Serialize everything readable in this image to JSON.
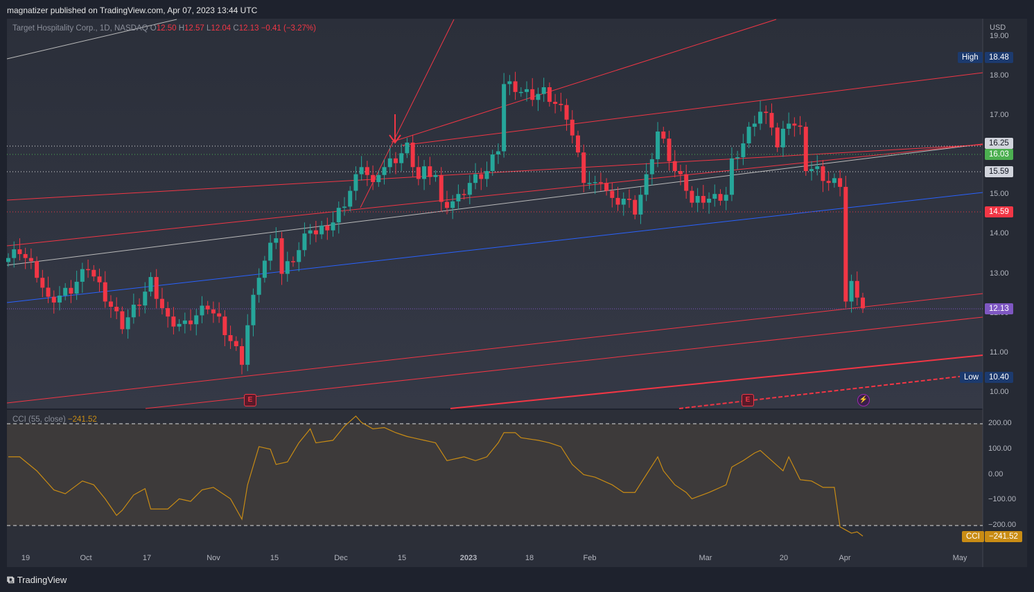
{
  "header": {
    "published": "magnatizer published on TradingView.com, Apr 07, 2023 13:44 UTC"
  },
  "legend": {
    "symbol": "Target Hospitality Corp., 1D, NASDAQ",
    "o_label": "O",
    "open": "12.50",
    "h_label": "H",
    "high": "12.57",
    "l_label": "L",
    "low": "12.04",
    "c_label": "C",
    "close": "12.13",
    "change": "−0.41 (−3.27%)"
  },
  "price_axis": {
    "currency": "USD",
    "ticks": [
      "19.00",
      "18.00",
      "17.00",
      "16.00",
      "15.00",
      "14.00",
      "13.00",
      "12.00",
      "11.00",
      "10.00"
    ]
  },
  "tags": {
    "high_label": "High",
    "high": "18.48",
    "low_label": "Low",
    "low": "10.40",
    "t1": "16.25",
    "t2": "16.03",
    "t3": "15.59",
    "t4": "14.59",
    "last": "12.13",
    "cci_label": "CCI",
    "cci": "−241.52"
  },
  "cci": {
    "title": "CCI (55, close)",
    "value": "−241.52",
    "ticks": [
      "200.00",
      "100.00",
      "0.00",
      "−100.00",
      "−200.00"
    ]
  },
  "time_axis": [
    "19",
    "Oct",
    "17",
    "Nov",
    "15",
    "Dec",
    "15",
    "2023",
    "18",
    "Feb",
    "Mar",
    "20",
    "Apr",
    "May"
  ],
  "earnings_label": "E",
  "footer": {
    "brand": "TradingView"
  },
  "colors": {
    "up": "#26a69a",
    "down": "#f23645",
    "cci": "#c98c14",
    "blue": "#2962ff"
  },
  "chart_data": {
    "type": "candlestick",
    "title": "Target Hospitality Corp., 1D, NASDAQ",
    "ylim": [
      9.7,
      19.3
    ],
    "close_path": [
      [
        0,
        13.4
      ],
      [
        2,
        13.6
      ],
      [
        5,
        13.0
      ],
      [
        7,
        12.3
      ],
      [
        11,
        12.6
      ],
      [
        14,
        13.2
      ],
      [
        17,
        12.4
      ],
      [
        20,
        11.7
      ],
      [
        23,
        12.3
      ],
      [
        25,
        12.8
      ],
      [
        28,
        11.8
      ],
      [
        31,
        11.7
      ],
      [
        35,
        12.2
      ],
      [
        37,
        11.8
      ],
      [
        41,
        10.8
      ],
      [
        42,
        11.7
      ],
      [
        44,
        13.0
      ],
      [
        47,
        14.0
      ],
      [
        48,
        13.0
      ],
      [
        51,
        13.6
      ],
      [
        53,
        14.2
      ],
      [
        54,
        14.0
      ],
      [
        57,
        14.3
      ],
      [
        59,
        14.8
      ],
      [
        61,
        15.4
      ],
      [
        62,
        15.8
      ],
      [
        64,
        15.2
      ],
      [
        65,
        15.6
      ],
      [
        67,
        15.8
      ],
      [
        68,
        15.9
      ],
      [
        70,
        16.2
      ],
      [
        72,
        15.4
      ],
      [
        73,
        15.6
      ],
      [
        75,
        15.5
      ],
      [
        76,
        14.7
      ],
      [
        79,
        14.9
      ],
      [
        81,
        15.3
      ],
      [
        84,
        15.6
      ],
      [
        86,
        16.2
      ],
      [
        87,
        17.8
      ],
      [
        89,
        17.7
      ],
      [
        90,
        17.6
      ],
      [
        92,
        17.5
      ],
      [
        94,
        17.6
      ],
      [
        96,
        17.3
      ],
      [
        98,
        17.0
      ],
      [
        99,
        16.5
      ],
      [
        101,
        15.4
      ],
      [
        103,
        15.2
      ],
      [
        104,
        15.4
      ],
      [
        106,
        14.8
      ],
      [
        108,
        14.9
      ],
      [
        110,
        14.6
      ],
      [
        112,
        15.4
      ],
      [
        114,
        16.6
      ],
      [
        115,
        16.3
      ],
      [
        117,
        15.6
      ],
      [
        119,
        15.2
      ],
      [
        120,
        14.8
      ],
      [
        122,
        14.9
      ],
      [
        124,
        14.9
      ],
      [
        126,
        15.0
      ],
      [
        127,
        15.8
      ],
      [
        129,
        16.3
      ],
      [
        131,
        16.9
      ],
      [
        132,
        17.1
      ],
      [
        134,
        16.8
      ],
      [
        135,
        16.2
      ],
      [
        137,
        16.9
      ],
      [
        139,
        16.6
      ],
      [
        140,
        15.7
      ],
      [
        142,
        15.6
      ],
      [
        144,
        15.3
      ],
      [
        146,
        15.3
      ],
      [
        147,
        12.3
      ],
      [
        148,
        12.7
      ],
      [
        149,
        12.5
      ],
      [
        150,
        12.13
      ]
    ],
    "cci_ylim": [
      -250,
      250
    ],
    "cci_path": [
      [
        0,
        70
      ],
      [
        2,
        70
      ],
      [
        5,
        15
      ],
      [
        8,
        -60
      ],
      [
        10,
        -75
      ],
      [
        13,
        -25
      ],
      [
        15,
        -40
      ],
      [
        17,
        -95
      ],
      [
        19,
        -160
      ],
      [
        20,
        -140
      ],
      [
        22,
        -80
      ],
      [
        24,
        -55
      ],
      [
        25,
        -135
      ],
      [
        28,
        -135
      ],
      [
        30,
        -95
      ],
      [
        32,
        -105
      ],
      [
        34,
        -60
      ],
      [
        36,
        -50
      ],
      [
        39,
        -95
      ],
      [
        41,
        -175
      ],
      [
        42,
        -40
      ],
      [
        44,
        110
      ],
      [
        46,
        100
      ],
      [
        47,
        40
      ],
      [
        49,
        50
      ],
      [
        51,
        125
      ],
      [
        53,
        180
      ],
      [
        54,
        125
      ],
      [
        57,
        135
      ],
      [
        59,
        190
      ],
      [
        61,
        230
      ],
      [
        62,
        205
      ],
      [
        64,
        180
      ],
      [
        66,
        185
      ],
      [
        68,
        165
      ],
      [
        70,
        150
      ],
      [
        73,
        135
      ],
      [
        75,
        125
      ],
      [
        77,
        55
      ],
      [
        80,
        70
      ],
      [
        82,
        55
      ],
      [
        84,
        70
      ],
      [
        86,
        125
      ],
      [
        87,
        165
      ],
      [
        89,
        165
      ],
      [
        90,
        145
      ],
      [
        93,
        135
      ],
      [
        95,
        125
      ],
      [
        97,
        110
      ],
      [
        99,
        40
      ],
      [
        101,
        0
      ],
      [
        103,
        -10
      ],
      [
        106,
        -40
      ],
      [
        108,
        -70
      ],
      [
        110,
        -70
      ],
      [
        112,
        0
      ],
      [
        114,
        70
      ],
      [
        115,
        15
      ],
      [
        117,
        -40
      ],
      [
        119,
        -70
      ],
      [
        120,
        -95
      ],
      [
        123,
        -70
      ],
      [
        124,
        -60
      ],
      [
        126,
        -40
      ],
      [
        127,
        30
      ],
      [
        129,
        55
      ],
      [
        131,
        85
      ],
      [
        132,
        95
      ],
      [
        134,
        55
      ],
      [
        136,
        15
      ],
      [
        137,
        70
      ],
      [
        139,
        -20
      ],
      [
        141,
        -25
      ],
      [
        143,
        -50
      ],
      [
        145,
        -50
      ],
      [
        146,
        -205
      ],
      [
        148,
        -230
      ],
      [
        149,
        -225
      ],
      [
        150,
        -241.52
      ]
    ]
  }
}
